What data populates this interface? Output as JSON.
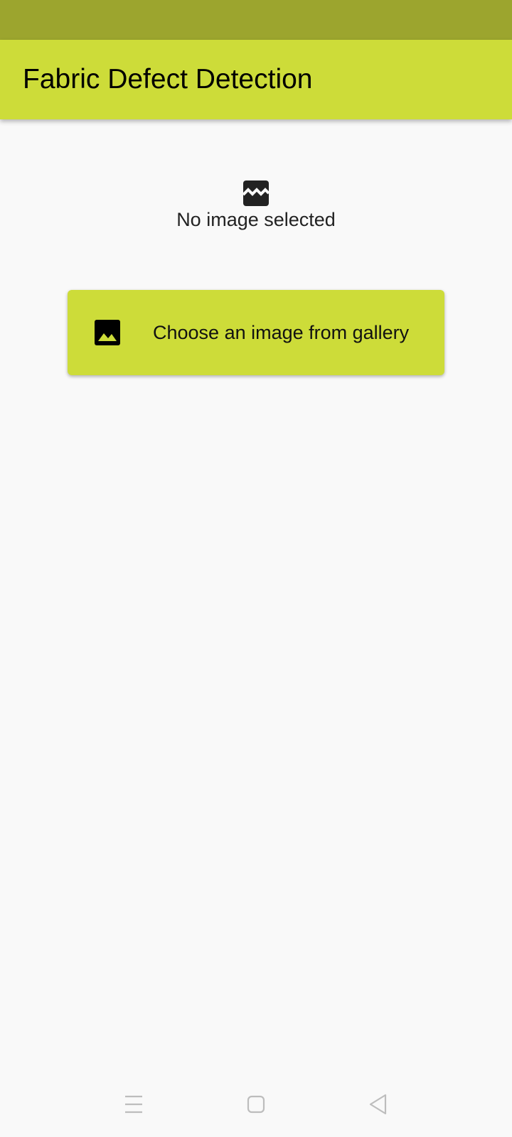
{
  "app": {
    "title": "Fabric Defect Detection"
  },
  "placeholder": {
    "icon": "broken-image-icon",
    "text": "No image selected"
  },
  "actions": {
    "gallery_button": {
      "icon": "image-icon",
      "label": "Choose an image from gallery"
    }
  },
  "navigation": {
    "items": [
      {
        "icon": "menu-icon"
      },
      {
        "icon": "home-square-icon"
      },
      {
        "icon": "back-triangle-icon"
      }
    ]
  },
  "colors": {
    "status_bar": "#9ca52e",
    "app_bar": "#cddc39",
    "button": "#cddc39",
    "background": "#f9f9f9"
  }
}
